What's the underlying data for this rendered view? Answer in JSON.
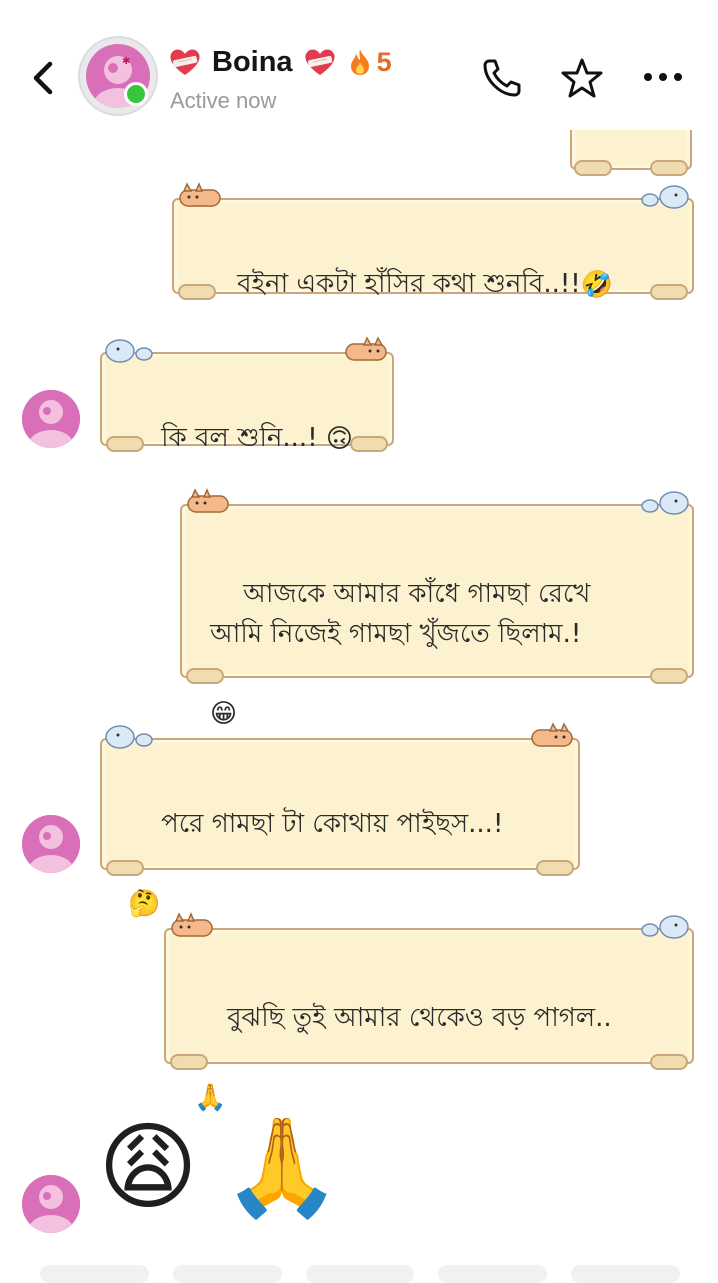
{
  "header": {
    "back_icon": "chevron-left-icon",
    "contact_name": "Boina",
    "status": "Active now",
    "streak_count": "5",
    "heart_icon": "heart-bandage-icon",
    "fire_icon": "fire-icon",
    "call_icon": "phone-icon",
    "star_icon": "star-icon",
    "more_icon": "more-dots-icon"
  },
  "messages": [
    {
      "side": "sent",
      "text": "বইনা একটা হাঁসির কথা শুনবি..!!",
      "emoji": "🤣"
    },
    {
      "side": "received",
      "text": "কি বল শুনি...! ",
      "emoji": "🙃"
    },
    {
      "side": "sent",
      "text": "আজকে আমার কাঁধে গামছা রেখে\nআমি নিজেই গামছা খুঁজতে ছিলাম.!",
      "emoji": "😁"
    },
    {
      "side": "received",
      "text": "পরে গামছা টা কোথায় পাইছস...!",
      "emoji": "🤔"
    },
    {
      "side": "sent",
      "text": "বুঝছি তুই আমার থেকেও বড় পাগল..",
      "emoji": "🙏"
    },
    {
      "side": "received",
      "type": "emoji-only",
      "emojis": [
        "😩",
        "🙏"
      ]
    }
  ],
  "colors": {
    "bubble_fill": "#fcf2cf",
    "bubble_border": "#caa77a",
    "online": "#37c53b",
    "streak": "#e46b2c",
    "avatar": "#d566b1"
  }
}
